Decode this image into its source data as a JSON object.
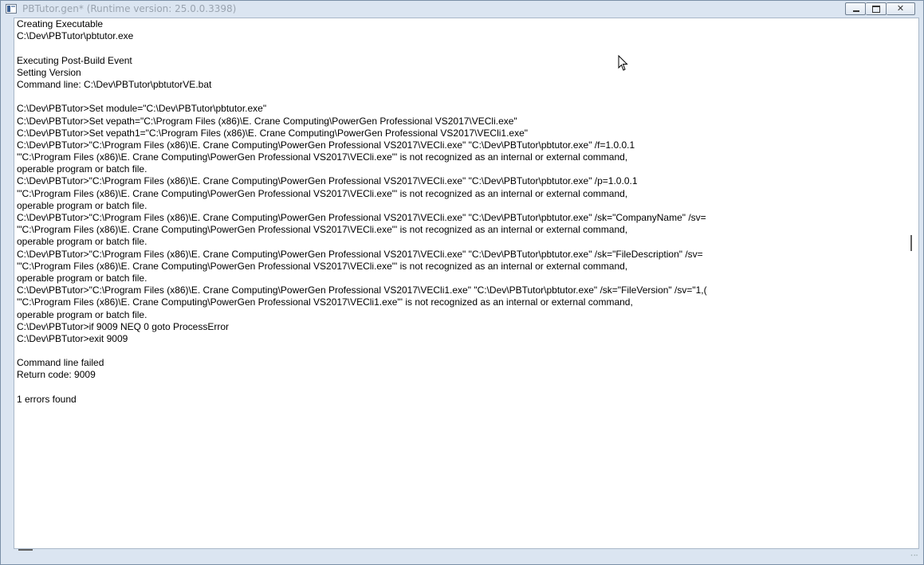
{
  "window": {
    "title": "PBTutor.gen* (Runtime version: 25.0.0.3398)",
    "close_glyph": "✕"
  },
  "log_lines": [
    "Creating Executable",
    "C:\\Dev\\PBTutor\\pbtutor.exe",
    "",
    "Executing Post-Build Event",
    "Setting Version",
    "Command line: C:\\Dev\\PBTutor\\pbtutorVE.bat",
    "",
    "C:\\Dev\\PBTutor>Set module=\"C:\\Dev\\PBTutor\\pbtutor.exe\"",
    "C:\\Dev\\PBTutor>Set vepath=\"C:\\Program Files (x86)\\E. Crane Computing\\PowerGen Professional VS2017\\VECli.exe\"",
    "C:\\Dev\\PBTutor>Set vepath1=\"C:\\Program Files (x86)\\E. Crane Computing\\PowerGen Professional VS2017\\VECli1.exe\"",
    "C:\\Dev\\PBTutor>\"C:\\Program Files (x86)\\E. Crane Computing\\PowerGen Professional VS2017\\VECli.exe\" \"C:\\Dev\\PBTutor\\pbtutor.exe\" /f=1.0.0.1",
    "'\"C:\\Program Files (x86)\\E. Crane Computing\\PowerGen Professional VS2017\\VECli.exe\"' is not recognized as an internal or external command,",
    "operable program or batch file.",
    "C:\\Dev\\PBTutor>\"C:\\Program Files (x86)\\E. Crane Computing\\PowerGen Professional VS2017\\VECli.exe\" \"C:\\Dev\\PBTutor\\pbtutor.exe\" /p=1.0.0.1",
    "'\"C:\\Program Files (x86)\\E. Crane Computing\\PowerGen Professional VS2017\\VECli.exe\"' is not recognized as an internal or external command,",
    "operable program or batch file.",
    "C:\\Dev\\PBTutor>\"C:\\Program Files (x86)\\E. Crane Computing\\PowerGen Professional VS2017\\VECli.exe\" \"C:\\Dev\\PBTutor\\pbtutor.exe\" /sk=\"CompanyName\" /sv=",
    "'\"C:\\Program Files (x86)\\E. Crane Computing\\PowerGen Professional VS2017\\VECli.exe\"' is not recognized as an internal or external command,",
    "operable program or batch file.",
    "C:\\Dev\\PBTutor>\"C:\\Program Files (x86)\\E. Crane Computing\\PowerGen Professional VS2017\\VECli.exe\" \"C:\\Dev\\PBTutor\\pbtutor.exe\" /sk=\"FileDescription\" /sv=",
    "'\"C:\\Program Files (x86)\\E. Crane Computing\\PowerGen Professional VS2017\\VECli.exe\"' is not recognized as an internal or external command,",
    "operable program or batch file.",
    "C:\\Dev\\PBTutor>\"C:\\Program Files (x86)\\E. Crane Computing\\PowerGen Professional VS2017\\VECli1.exe\" \"C:\\Dev\\PBTutor\\pbtutor.exe\" /sk=\"FileVersion\" /sv=\"1,(",
    "'\"C:\\Program Files (x86)\\E. Crane Computing\\PowerGen Professional VS2017\\VECli1.exe\"' is not recognized as an internal or external command,",
    "operable program or batch file.",
    "C:\\Dev\\PBTutor>if 9009 NEQ 0 goto ProcessError",
    "C:\\Dev\\PBTutor>exit 9009",
    "",
    "Command line failed",
    "Return code: 9009",
    "",
    "1 errors found"
  ]
}
